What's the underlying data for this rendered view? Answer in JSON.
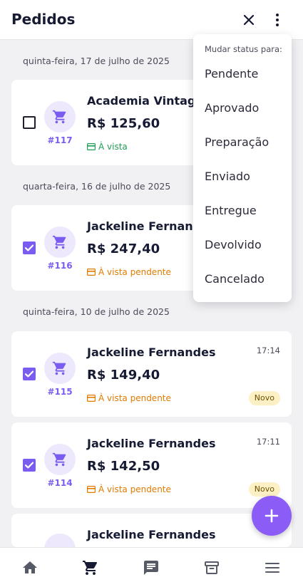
{
  "header": {
    "title": "Pedidos",
    "close_icon": "close-icon",
    "more_icon": "more-vert-icon"
  },
  "groups": [
    {
      "date": "quinta-feira, 17 de julho de 2025"
    },
    {
      "date": "quarta-feira, 16 de julho de 2025"
    },
    {
      "date": "quinta-feira, 10 de julho de 2025"
    }
  ],
  "orders": [
    {
      "number": "#117",
      "customer": "Academia Vintage C",
      "amount": "R$ 125,60",
      "payment": "À vista",
      "checked": false,
      "time": "",
      "badge": ""
    },
    {
      "number": "#116",
      "customer": "Jackeline Fernandes",
      "amount": "R$ 247,40",
      "payment": "À vista pendente",
      "checked": true,
      "time": "",
      "badge": ""
    },
    {
      "number": "#115",
      "customer": "Jackeline Fernandes",
      "amount": "R$ 149,40",
      "payment": "À vista pendente",
      "checked": true,
      "time": "17:14",
      "badge": "Novo"
    },
    {
      "number": "#114",
      "customer": "Jackeline Fernandes",
      "amount": "R$ 142,50",
      "payment": "À vista pendente",
      "checked": true,
      "time": "17:11",
      "badge": "Novo"
    },
    {
      "number": "",
      "customer": "Jackeline Fernandes",
      "amount": "",
      "payment": "",
      "checked": true,
      "time": "",
      "badge": ""
    }
  ],
  "status_menu": {
    "header": "Mudar status para:",
    "items": [
      "Pendente",
      "Aprovado",
      "Preparação",
      "Enviado",
      "Entregue",
      "Devolvido",
      "Cancelado"
    ]
  },
  "fab": {
    "icon": "plus-icon"
  },
  "bottom_nav": [
    {
      "icon": "home-icon",
      "active": false
    },
    {
      "icon": "cart-icon",
      "active": true
    },
    {
      "icon": "chat-icon",
      "active": false
    },
    {
      "icon": "archive-icon",
      "active": false
    },
    {
      "icon": "menu-icon",
      "active": false
    }
  ],
  "colors": {
    "accent": "#7b5cf0",
    "fab": "#8b5cf6",
    "paid": "#1f9d55",
    "pending": "#e07b00",
    "badge_bg": "#fdf0c4"
  }
}
